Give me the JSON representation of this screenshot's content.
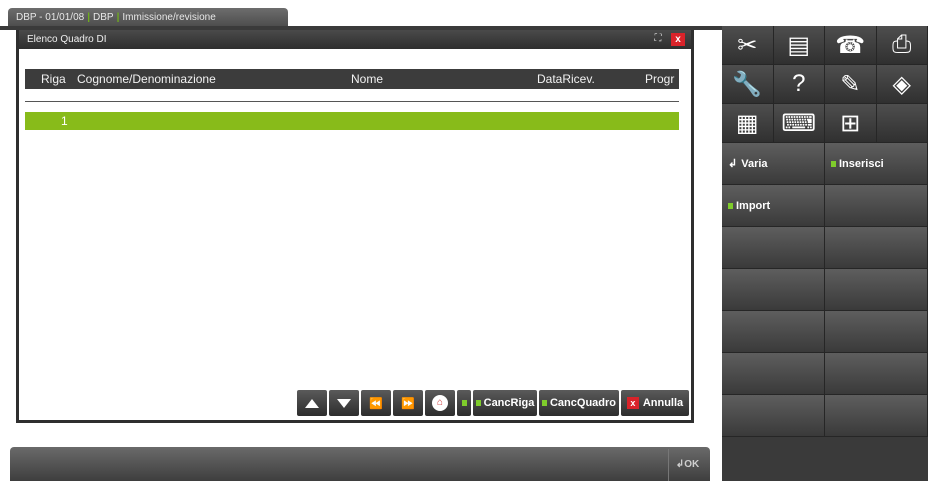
{
  "tab": {
    "part1": "DBP - 01/01/08",
    "part2": "DBP",
    "part3": "Immissione/revisione"
  },
  "window": {
    "title": "Elenco Quadro DI",
    "columns": [
      "Riga",
      "Cognome/Denominazione",
      "Nome",
      "DataRicev.",
      "Progr"
    ],
    "selected_row": {
      "riga": "1"
    }
  },
  "nav": {
    "canc_riga": "CancRiga",
    "canc_quadro": "CancQuadro",
    "annulla": "Annulla"
  },
  "bottom": {
    "ok_label": "OK"
  },
  "side": {
    "icons_row1": [
      "scissors-icon",
      "document-icon",
      "fax-icon",
      "printer-icon"
    ],
    "icons_row2": [
      "wrench-icon",
      "help-icon",
      "notes-icon",
      "cube-icon"
    ],
    "icons_row3": [
      "calculator-icon",
      "keyboard-icon",
      "grid-icon",
      ""
    ],
    "varia_label": "Varia",
    "inserisci_label": "Inserisci",
    "import_label": "Import"
  },
  "colors": {
    "accent_green": "#88bb1a",
    "close_red": "#d9232a"
  }
}
